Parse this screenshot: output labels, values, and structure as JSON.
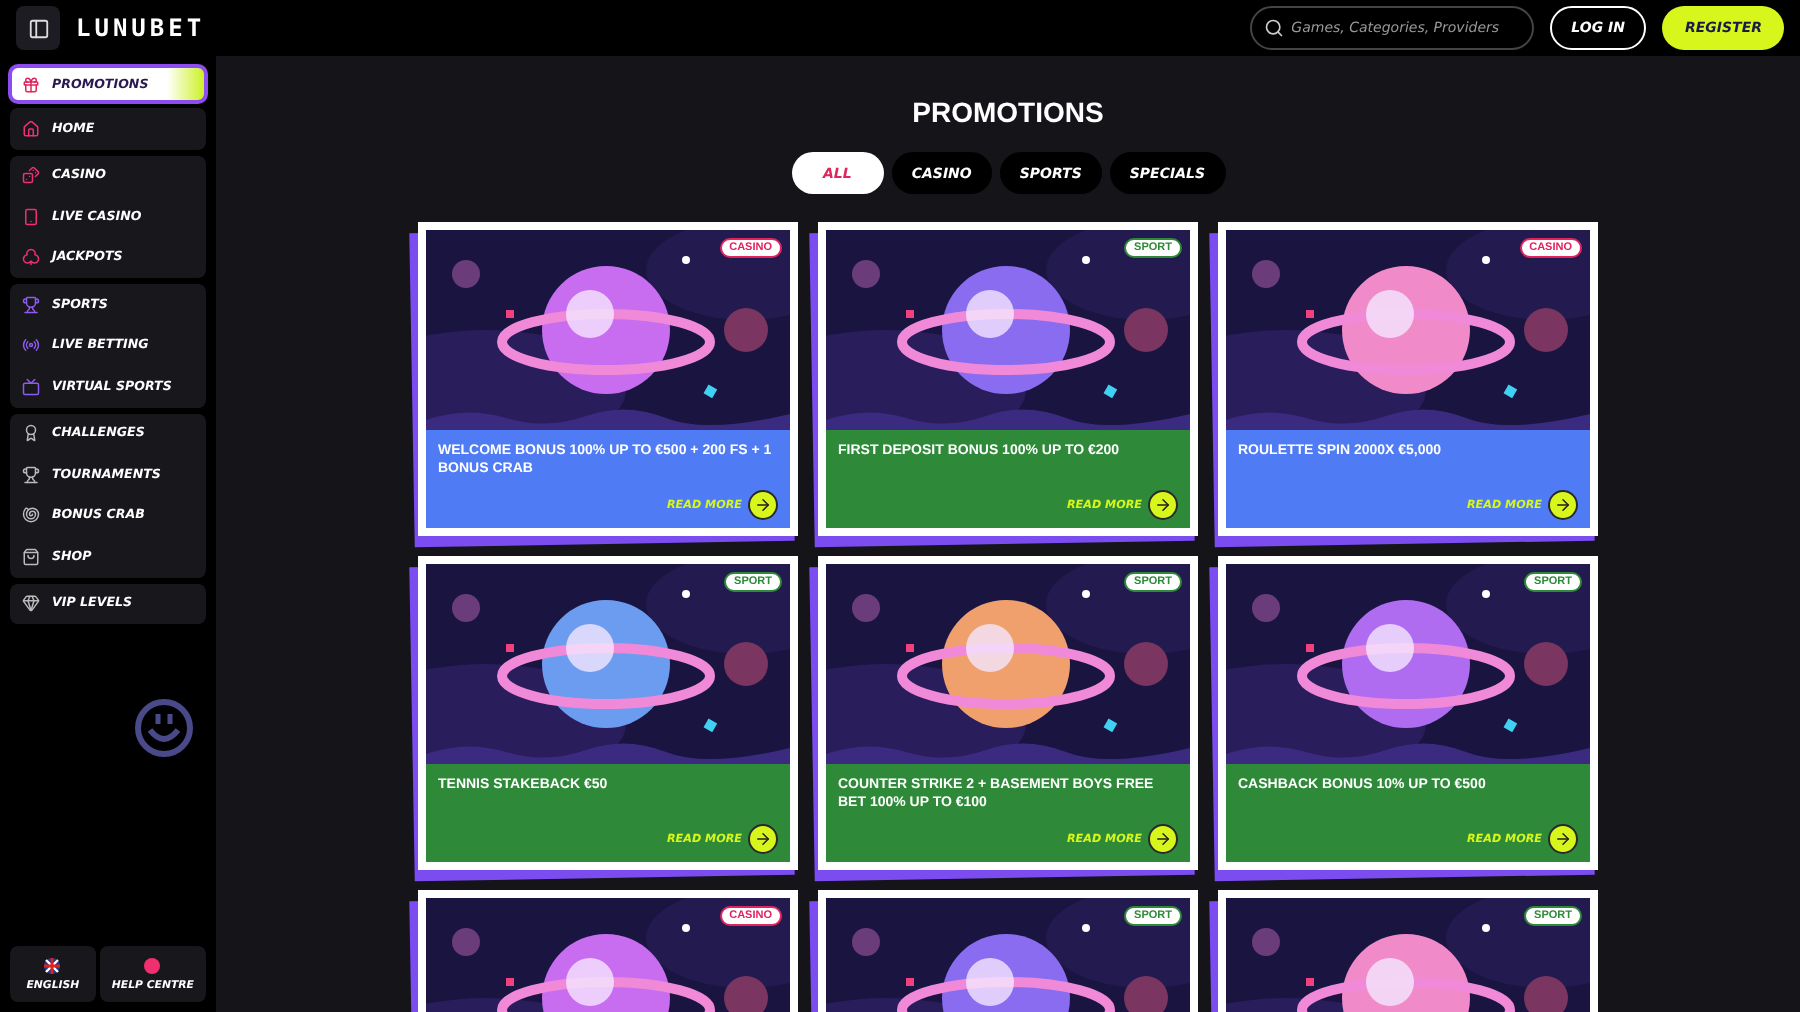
{
  "header": {
    "logo": "LUNUBET",
    "search": {
      "placeholder": "Games, Categories, Providers"
    },
    "login": "LOG IN",
    "register": "REGISTER"
  },
  "sidebar": {
    "groups": [
      [
        {
          "label": "PROMOTIONS",
          "kind": "promo",
          "selected": true
        }
      ],
      [
        {
          "label": "HOME",
          "kind": "home",
          "selected": false
        }
      ],
      [
        {
          "label": "CASINO",
          "kind": "casino",
          "selected": false
        },
        {
          "label": "LIVE CASINO",
          "kind": "live-casino",
          "selected": false
        },
        {
          "label": "JACKPOTS",
          "kind": "jackpots",
          "selected": false
        }
      ],
      [
        {
          "label": "SPORTS",
          "kind": "sports",
          "selected": false
        },
        {
          "label": "LIVE BETTING",
          "kind": "live-betting",
          "selected": false
        },
        {
          "label": "VIRTUAL SPORTS",
          "kind": "virtual",
          "selected": false
        }
      ],
      [
        {
          "label": "CHALLENGES",
          "kind": "challenges",
          "selected": false
        },
        {
          "label": "TOURNAMENTS",
          "kind": "tournaments",
          "selected": false
        },
        {
          "label": "BONUS CRAB",
          "kind": "crab",
          "selected": false
        },
        {
          "label": "SHOP",
          "kind": "shop",
          "selected": false
        }
      ],
      [
        {
          "label": "VIP LEVELS",
          "kind": "vip",
          "selected": false
        }
      ]
    ],
    "footer": [
      {
        "label": "ENGLISH",
        "kind": "language"
      },
      {
        "label": "HELP CENTRE",
        "kind": "help"
      }
    ]
  },
  "title": "PROMOTIONS",
  "filters": [
    {
      "label": "ALL",
      "selected": true
    },
    {
      "label": "CASINO",
      "selected": false
    },
    {
      "label": "SPORTS",
      "selected": false
    },
    {
      "label": "SPECIALS",
      "selected": false
    }
  ],
  "promotions": [
    {
      "tag": "CASINO",
      "kind": "casino",
      "title": "WELCOME BONUS 100% UP TO €500 + 200 FS + 1 BONUS CRAB",
      "link": "READ MORE"
    },
    {
      "tag": "SPORT",
      "kind": "sport",
      "title": "FIRST DEPOSIT BONUS 100% UP TO €200",
      "link": "READ MORE"
    },
    {
      "tag": "CASINO",
      "kind": "casino",
      "title": "ROULETTE SPIN 2000X €5,000",
      "link": "READ MORE"
    },
    {
      "tag": "SPORT",
      "kind": "sport",
      "title": "TENNIS STAKEBACK €50",
      "link": "READ MORE"
    },
    {
      "tag": "SPORT",
      "kind": "sport",
      "title": "COUNTER STRIKE 2 + BASEMENT BOYS FREE BET 100% UP TO €100",
      "link": "READ MORE"
    },
    {
      "tag": "SPORT",
      "kind": "sport",
      "title": "CASHBACK BONUS 10% UP TO €500",
      "link": "READ MORE"
    },
    {
      "tag": "CASINO",
      "kind": "casino"
    },
    {
      "tag": "SPORT",
      "kind": "sport"
    },
    {
      "tag": "SPORT",
      "kind": "sport"
    }
  ]
}
